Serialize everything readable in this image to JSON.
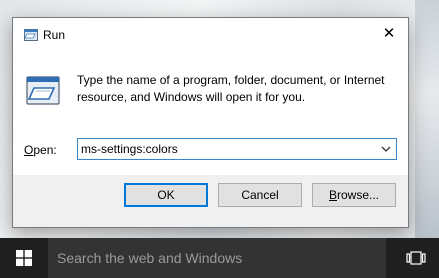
{
  "window": {
    "title": "Run",
    "close_glyph": "✕"
  },
  "run": {
    "description": "Type the name of a program, folder, document, or Internet resource, and Windows will open it for you.",
    "open_label_prefix": "",
    "open_label_accel": "O",
    "open_label_rest": "pen:",
    "command_value": "ms-settings:colors"
  },
  "buttons": {
    "ok": "OK",
    "cancel": "Cancel",
    "browse_accel": "B",
    "browse_rest": "rowse..."
  },
  "taskbar": {
    "search_placeholder": "Search the web and Windows"
  },
  "icons": {
    "run_small": "run-icon",
    "run_big": "run-icon",
    "dropdown": "chevron-down-icon",
    "start": "windows-logo-icon",
    "task_view": "task-view-icon"
  },
  "colors": {
    "accent": "#0078d7",
    "taskbar": "#1f1f1f",
    "search_box": "#333333"
  }
}
